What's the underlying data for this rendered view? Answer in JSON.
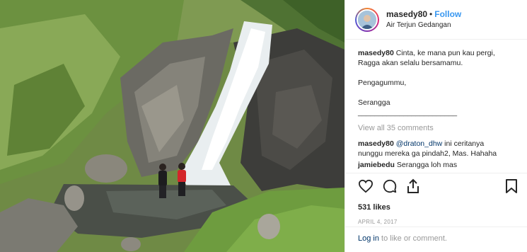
{
  "header": {
    "username": "masedy80",
    "separator": "•",
    "follow_label": "Follow",
    "location": "Air Terjun Gedangan"
  },
  "caption": {
    "username": "masedy80",
    "line1": "Cinta, ke mana pun kau pergi,",
    "line2": "Ragga akan selalu bersamamu.",
    "line3": "Pengagummu,",
    "line4": "Serangga",
    "line5": "________________________"
  },
  "view_all": "View all 35 comments",
  "comments": [
    {
      "username": "masedy80",
      "mention": "@draton_dhw",
      "text_a": " ini ceritanya",
      "text_b": "nunggu mereka ga pindah2, Mas. Hahaha"
    },
    {
      "username": "jamiebedu",
      "text": "Serangga loh mas"
    }
  ],
  "icons": {
    "like": "heart-icon",
    "comment": "comment-icon",
    "share": "share-icon",
    "save": "bookmark-icon"
  },
  "likes": "531 likes",
  "date": "APRIL 4, 2017",
  "login": {
    "link": "Log in",
    "text": " to like or comment."
  }
}
